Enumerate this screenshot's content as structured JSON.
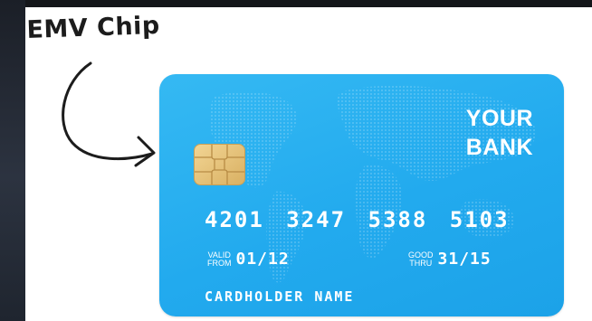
{
  "annotation": {
    "label": "EMV Chip"
  },
  "card": {
    "bank_line_1": "YOUR",
    "bank_line_2": "BANK",
    "number": "4201 3247 5388 5103",
    "valid_from_caption_1": "VALID",
    "valid_from_caption_2": "FROM",
    "valid_from": "01/12",
    "good_thru_caption_1": "GOOD",
    "good_thru_caption_2": "THRU",
    "good_thru": "31/15",
    "cardholder": "CARDHOLDER NAME",
    "color": "#22aaee",
    "chip_color": "#e8c57e"
  },
  "icons": {
    "arrow": "curved-arrow-icon",
    "chip": "chip-icon",
    "map": "world-map-icon"
  }
}
